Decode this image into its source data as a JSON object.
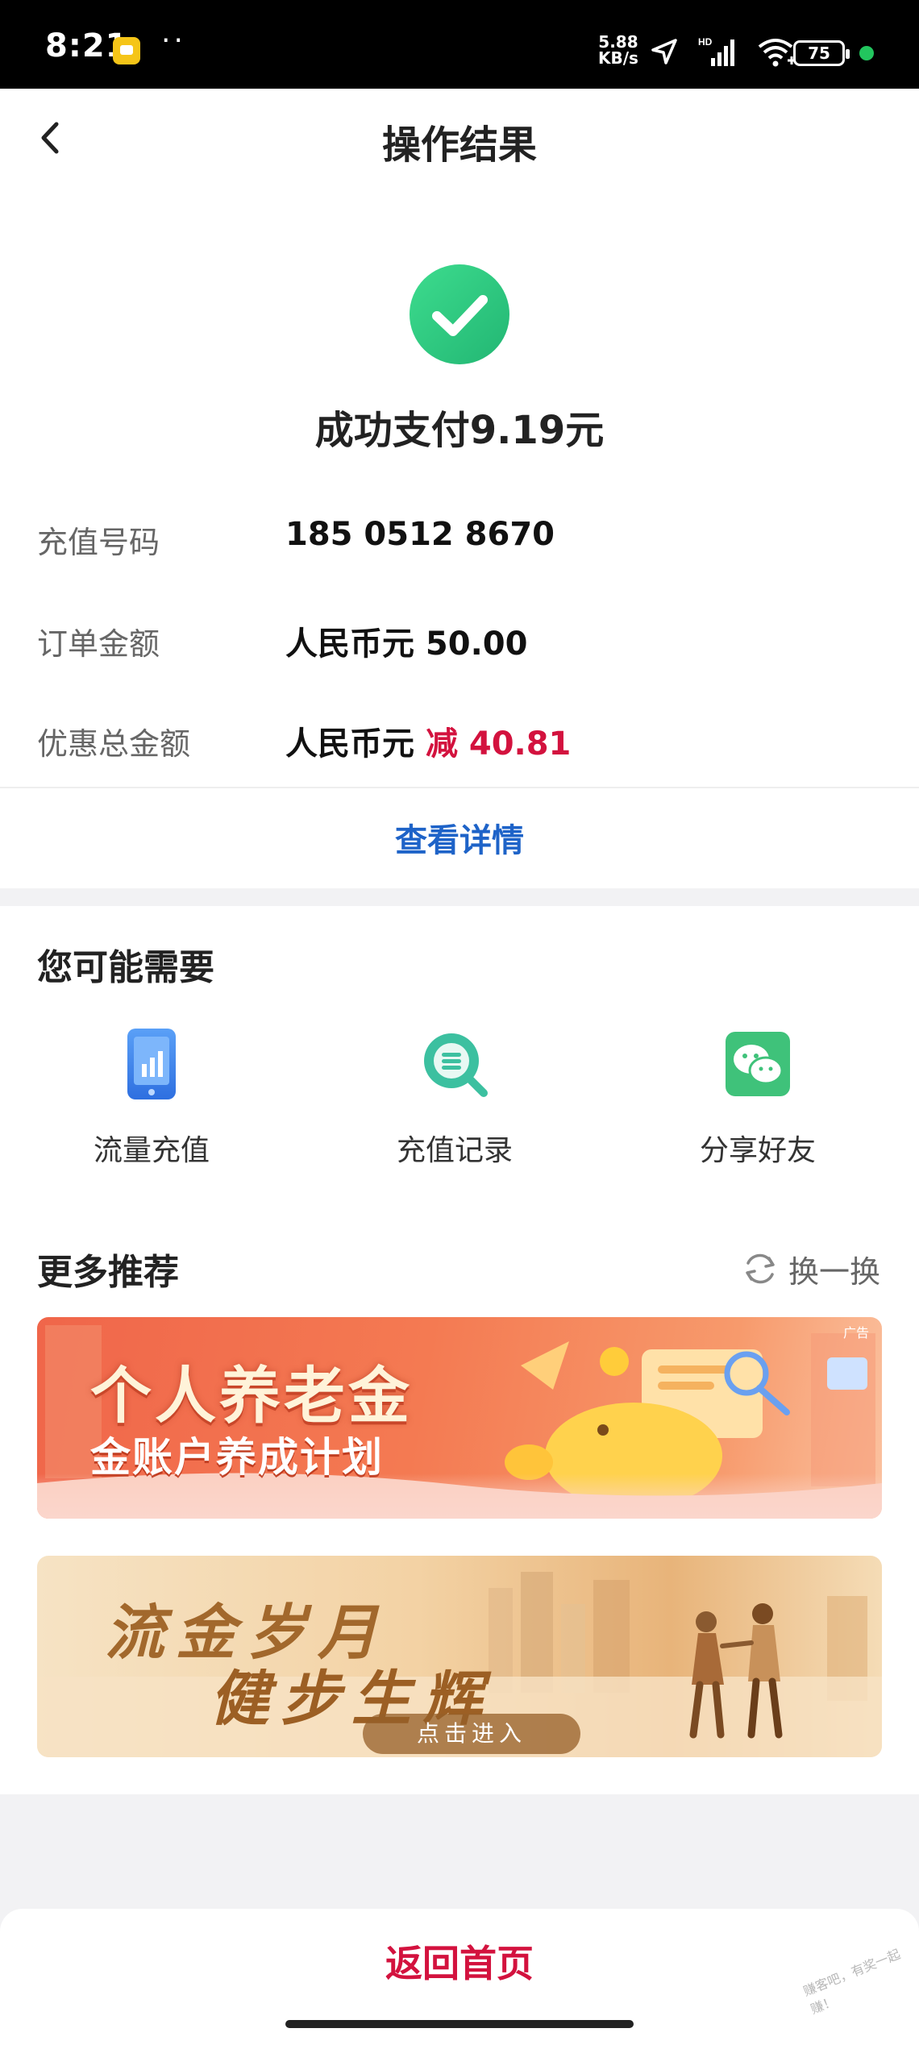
{
  "status_bar": {
    "time": "8:21",
    "dots": "··",
    "net_speed_value": "5.88",
    "net_speed_unit": "KB/s",
    "hd_badge": "HD",
    "battery": "75"
  },
  "header": {
    "title": "操作结果"
  },
  "result": {
    "message": "成功支付9.19元"
  },
  "details": {
    "rows": [
      {
        "label": "充值号码",
        "value": "185 0512 8670"
      },
      {
        "label": "订单金额",
        "value": "人民币元 50.00"
      },
      {
        "label": "优惠总金额",
        "value_prefix": "人民币元",
        "value_highlight": "减 40.81"
      }
    ],
    "view_details": "查看详情"
  },
  "you_may_need": {
    "title": "您可能需要",
    "items": [
      {
        "label": "流量充值",
        "icon": "phone-data-icon"
      },
      {
        "label": "充值记录",
        "icon": "search-record-icon"
      },
      {
        "label": "分享好友",
        "icon": "wechat-icon"
      }
    ]
  },
  "recommend": {
    "title": "更多推荐",
    "refresh_label": "换一换",
    "banners": [
      {
        "title": "个人养老金",
        "subtitle": "金账户养成计划",
        "ad_tag": "广告"
      },
      {
        "line1": "流金岁月",
        "line2": "健步生辉",
        "button": "点击进入"
      }
    ]
  },
  "footer": {
    "home_label": "返回首页",
    "watermark": "赚客吧，有奖一起赚！"
  },
  "colors": {
    "accent_red": "#d3123e",
    "link_blue": "#1e63c8",
    "success_green": "#2fc77f"
  }
}
